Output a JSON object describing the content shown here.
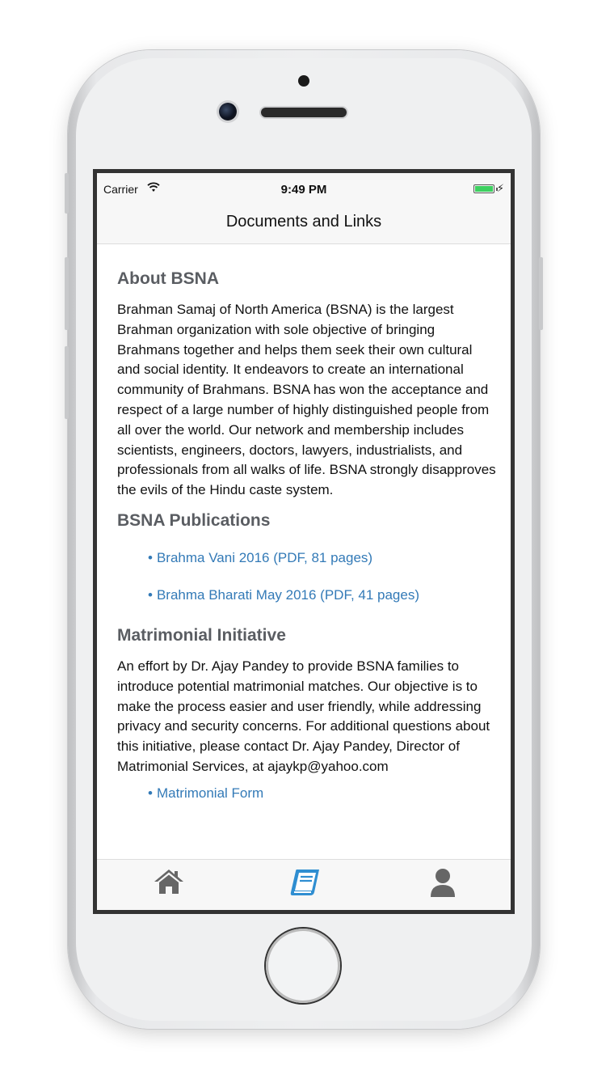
{
  "status": {
    "carrier": "Carrier",
    "time": "9:49 PM",
    "wifi_icon": "wifi-icon",
    "battery_icon": "battery-icon"
  },
  "nav": {
    "title": "Documents and Links"
  },
  "about": {
    "title": "About BSNA",
    "text": "Brahman Samaj of North America (BSNA) is the largest Brahman organization with sole objective of bringing Brahmans together and helps them seek their own cultural and social identity. It endeavors to create an international community of Brahmans. BSNA has won the acceptance and respect of a large number of highly distinguished people from all over the world. Our network and membership includes scientists, engineers, doctors, lawyers, industrialists, and professionals from all walks of life. BSNA strongly disapproves the evils of the Hindu caste system."
  },
  "publications": {
    "title": "BSNA Publications",
    "links": [
      {
        "label": "Brahma Vani 2016 (PDF, 81 pages)"
      },
      {
        "label": "Brahma Bharati May 2016 (PDF, 41 pages)"
      }
    ]
  },
  "matrimonial": {
    "title": "Matrimonial Initiative",
    "text": "An effort by Dr. Ajay Pandey to provide BSNA families to introduce potential matrimonial matches. Our objective is to make the process easier and user friendly, while addressing privacy and security concerns. For additional questions about this initiative, please contact Dr. Ajay Pandey, Director of Matrimonial Services, at ajaykp@yahoo.com",
    "links": [
      {
        "label": "Matrimonial Form"
      }
    ]
  },
  "tabs": [
    {
      "name": "home-icon",
      "active": false
    },
    {
      "name": "book-icon",
      "active": true
    },
    {
      "name": "user-icon",
      "active": false
    }
  ],
  "colors": {
    "link": "#337ab7",
    "active_tab": "#2f8ed1",
    "inactive_tab": "#666666",
    "heading": "#5a5d62"
  }
}
